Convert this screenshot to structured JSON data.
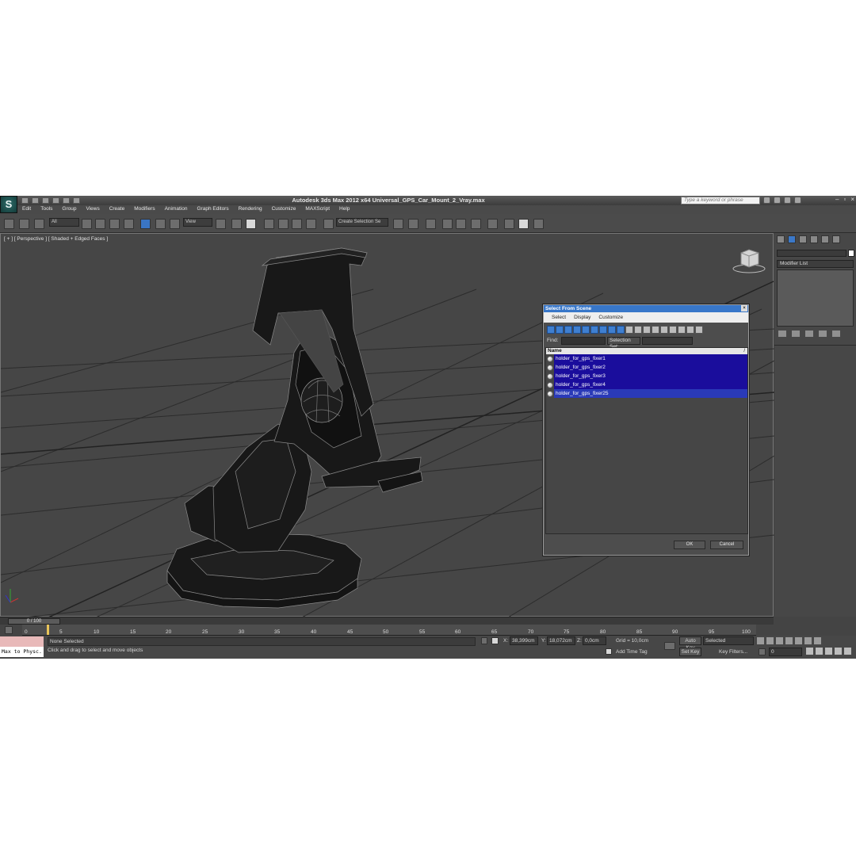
{
  "window": {
    "title": "Autodesk 3ds Max  2012 x64      Universal_GPS_Car_Mount_2_Vray.max",
    "search_placeholder": "Type a keyword or phrase",
    "logo_glyph": "S"
  },
  "menu": [
    "Edit",
    "Tools",
    "Group",
    "Views",
    "Create",
    "Modifiers",
    "Animation",
    "Graph Editors",
    "Rendering",
    "Customize",
    "MAXScript",
    "Help"
  ],
  "toolbar": {
    "filter_value": "All",
    "ref_coord_value": "View",
    "selection_set_placeholder": "Create Selection Se"
  },
  "viewport": {
    "label": "[ + ] [ Perspective ] [ Shaded + Edged Faces ]"
  },
  "command_panel": {
    "modifier_list": "Modifier List"
  },
  "dialog": {
    "title": "Select From Scene",
    "close_glyph": "×",
    "menus": [
      "Select",
      "Display",
      "Customize"
    ],
    "find_label": "Find:",
    "selection_set_label": "Selection Set:",
    "column_header": "Name",
    "sort_mark": "/",
    "items": [
      "holder_for_gps_fixer1",
      "holder_for_gps_fixer2",
      "holder_for_gps_fixer3",
      "holder_for_gps_fixer4",
      "holder_for_gps_fixer25"
    ],
    "ok_label": "OK",
    "cancel_label": "Cancel"
  },
  "timeline": {
    "slider_label": "0 / 100",
    "ticks": [
      "0",
      "5",
      "10",
      "15",
      "20",
      "25",
      "30",
      "35",
      "40",
      "45",
      "50",
      "55",
      "60",
      "65",
      "70",
      "75",
      "80",
      "85",
      "90",
      "95",
      "100"
    ]
  },
  "status": {
    "maxscript_label": "Max to Physc.",
    "selection_status": "None Selected",
    "prompt": "Click and drag to select and move objects",
    "x_label": "X:",
    "x_value": "38,399cm",
    "y_label": "Y:",
    "y_value": "18,072cm",
    "z_label": "Z:",
    "z_value": "0,0cm",
    "grid": "Grid = 10,0cm",
    "add_time_tag": "Add Time Tag",
    "auto_key": "Auto Key",
    "set_key": "Set Key",
    "selected_dropdown": "Selected",
    "key_filters": "Key Filters...",
    "frame_value": "0"
  },
  "colors": {
    "selection_blue": "#1a0d9c",
    "title_blue": "#3877c9",
    "viewport_bg": "#464646"
  }
}
